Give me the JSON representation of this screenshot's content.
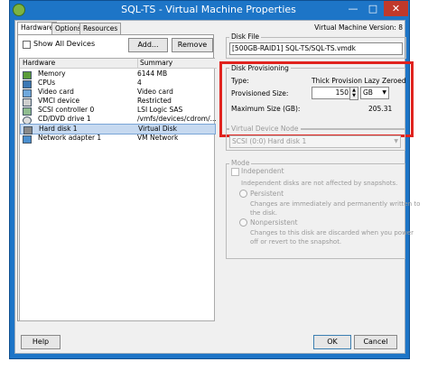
{
  "window": {
    "title": "SQL-TS - Virtual Machine Properties",
    "minimize": "—",
    "maximize": "□",
    "close": "✕",
    "vm_version": "Virtual Machine Version: 8"
  },
  "tabs": [
    "Hardware",
    "Options",
    "Resources"
  ],
  "left": {
    "show_all_devices": "Show All Devices",
    "add_button": "Add...",
    "remove_button": "Remove",
    "col_hardware": "Hardware",
    "col_summary": "Summary",
    "rows": [
      {
        "name": "Memory",
        "summary": "6144 MB",
        "icon": "memory-icon"
      },
      {
        "name": "CPUs",
        "summary": "4",
        "icon": "cpu-icon"
      },
      {
        "name": "Video card",
        "summary": "Video card",
        "icon": "video-card-icon"
      },
      {
        "name": "VMCI device",
        "summary": "Restricted",
        "icon": "vmci-icon"
      },
      {
        "name": "SCSI controller 0",
        "summary": "LSI Logic SAS",
        "icon": "scsi-controller-icon"
      },
      {
        "name": "CD/DVD drive 1",
        "summary": "/vmfs/devices/cdrom/...",
        "icon": "cd-drive-icon"
      },
      {
        "name": "Hard disk 1",
        "summary": "Virtual Disk",
        "icon": "hard-disk-icon"
      },
      {
        "name": "Network adapter 1",
        "summary": "VM Network",
        "icon": "network-adapter-icon"
      }
    ]
  },
  "right": {
    "disk_file_label": "Disk File",
    "disk_file_value": "[500GB-RAID1] SQL-TS/SQL-TS.vmdk",
    "provisioning": {
      "group_label": "Disk Provisioning",
      "type_label": "Type:",
      "type_value": "Thick Provision Lazy Zeroed",
      "size_label": "Provisioned Size:",
      "size_value": "150",
      "size_unit": "GB",
      "max_label": "Maximum Size (GB):",
      "max_value": "205.31"
    },
    "vdn": {
      "group_label": "Virtual Device Node",
      "value": "SCSI (0:0) Hard disk 1"
    },
    "mode": {
      "group_label": "Mode",
      "independent": "Independent",
      "independent_desc": "Independent disks are not affected by snapshots.",
      "persistent": "Persistent",
      "persistent_desc_1": "Changes are immediately and permanently written to",
      "persistent_desc_2": "the disk.",
      "nonpersistent": "Nonpersistent",
      "nonpersistent_desc_1": "Changes to this disk are discarded when you power",
      "nonpersistent_desc_2": "off or revert to the snapshot."
    }
  },
  "footer": {
    "help": "Help",
    "ok": "OK",
    "cancel": "Cancel"
  },
  "colors": {
    "titlebar": "#1d75c7",
    "highlight": "#e0231e",
    "selection": "#c6d9f0"
  }
}
